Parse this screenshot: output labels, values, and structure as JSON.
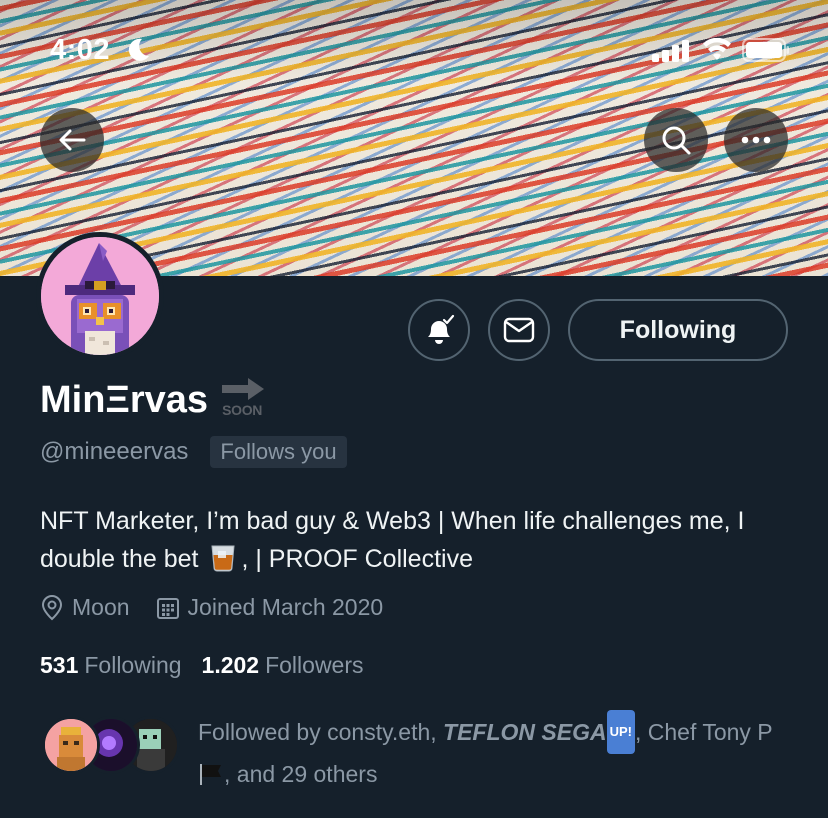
{
  "status_bar": {
    "time": "4:02"
  },
  "profile": {
    "name": "MinΞrvas",
    "soon_badge": "SOON",
    "handle": "@mineeervas",
    "follows_you": "Follows you",
    "bio_part1": "NFT Marketer, I’m bad guy & Web3 | When life challenges me, I double the bet",
    "bio_part2": ", | PROOF Collective",
    "location": "Moon",
    "joined": "Joined March 2020",
    "following_count": "531",
    "following_label": "Following",
    "followers_count": "1.202",
    "followers_label": "Followers"
  },
  "actions": {
    "following_button": "Following"
  },
  "followed_by": {
    "prefix": "Followed by consty.eth, ",
    "teflon": "TEFLON SEGA",
    "up_badge": "UP!",
    "middle": ", Chef Tony P ",
    "suffix": ", and 29 others"
  },
  "icons": {
    "back": "arrow-left-icon",
    "search": "search-icon",
    "more": "more-horizontal-icon",
    "bell": "bell-check-icon",
    "mail": "envelope-icon",
    "location": "location-pin-icon",
    "calendar": "calendar-icon"
  },
  "colors": {
    "background": "#15202b",
    "secondary_text": "#8b98a5",
    "border": "#536471",
    "avatar_bg": "#f3a9d8"
  }
}
